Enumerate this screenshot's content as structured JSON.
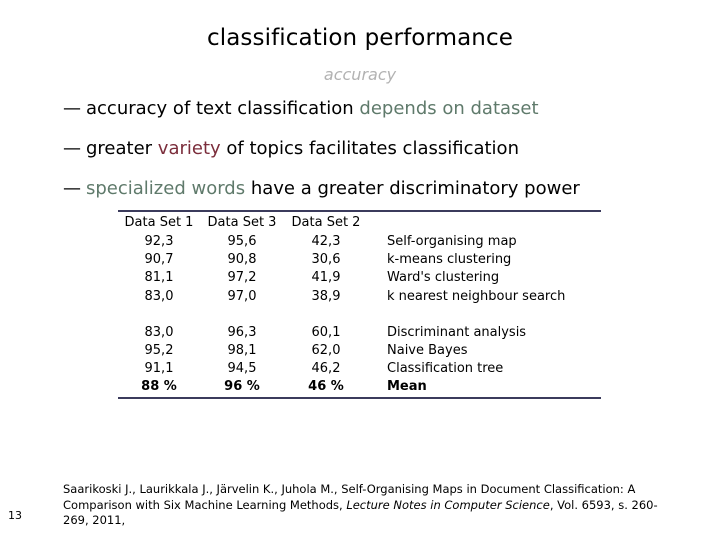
{
  "slide": {
    "title": "classification performance",
    "subtitle": "accuracy",
    "page_number": "13"
  },
  "colors": {
    "green_highlight": "#5f7a6b",
    "maroon_highlight": "#7b2d3b",
    "subtitle_gray": "#b2b2b2",
    "rule_navy": "#3b3b5c"
  },
  "bullets": [
    {
      "dash": "—",
      "plain_a": "accuracy of text classification ",
      "highlight": "depends on dataset",
      "highlight_style": "green",
      "plain_b": ""
    },
    {
      "dash": "—",
      "plain_a": "greater ",
      "highlight": "variety",
      "highlight_style": "maroon",
      "plain_b": " of topics facilitates classification"
    },
    {
      "dash": "—",
      "plain_a": "",
      "highlight": "specialized words",
      "highlight_style": "green",
      "plain_b": " have a greater discriminatory power"
    }
  ],
  "table": {
    "headers": [
      "Data Set 1",
      "Data Set 3",
      "Data Set 2",
      ""
    ],
    "rows": [
      {
        "c1": "92,3",
        "c2": "95,6",
        "c3": "42,3",
        "label": "Self-organising map",
        "bold": false,
        "tall": false
      },
      {
        "c1": "90,7",
        "c2": "90,8",
        "c3": "30,6",
        "label": "k-means clustering",
        "bold": false,
        "tall": false
      },
      {
        "c1": "81,1",
        "c2": "97,2",
        "c3": "41,9",
        "label": "Ward's clustering",
        "bold": false,
        "tall": false
      },
      {
        "c1": "83,0",
        "c2": "97,0",
        "c3": "38,9",
        "label": "k nearest neighbour search",
        "bold": false,
        "tall": true
      },
      {
        "c1": "83,0",
        "c2": "96,3",
        "c3": "60,1",
        "label": "Discriminant analysis",
        "bold": false,
        "tall": false
      },
      {
        "c1": "95,2",
        "c2": "98,1",
        "c3": "62,0",
        "label": "Naive Bayes",
        "bold": false,
        "tall": false
      },
      {
        "c1": "91,1",
        "c2": "94,5",
        "c3": "46,2",
        "label": "Classification tree",
        "bold": false,
        "tall": false
      },
      {
        "c1": "88 %",
        "c2": "96 %",
        "c3": "46 %",
        "label": "Mean",
        "bold": true,
        "tall": false
      }
    ]
  },
  "citation": {
    "part1": "Saarikoski J., Laurikkala J., Järvelin K., Juhola M., Self-Organising Maps in Document Classification: A Comparison with Six Machine Learning Methods, ",
    "italic1": "Lecture Notes in Computer Science",
    "part2": ", Vol. 6593, s. 260-269, 2011,"
  }
}
